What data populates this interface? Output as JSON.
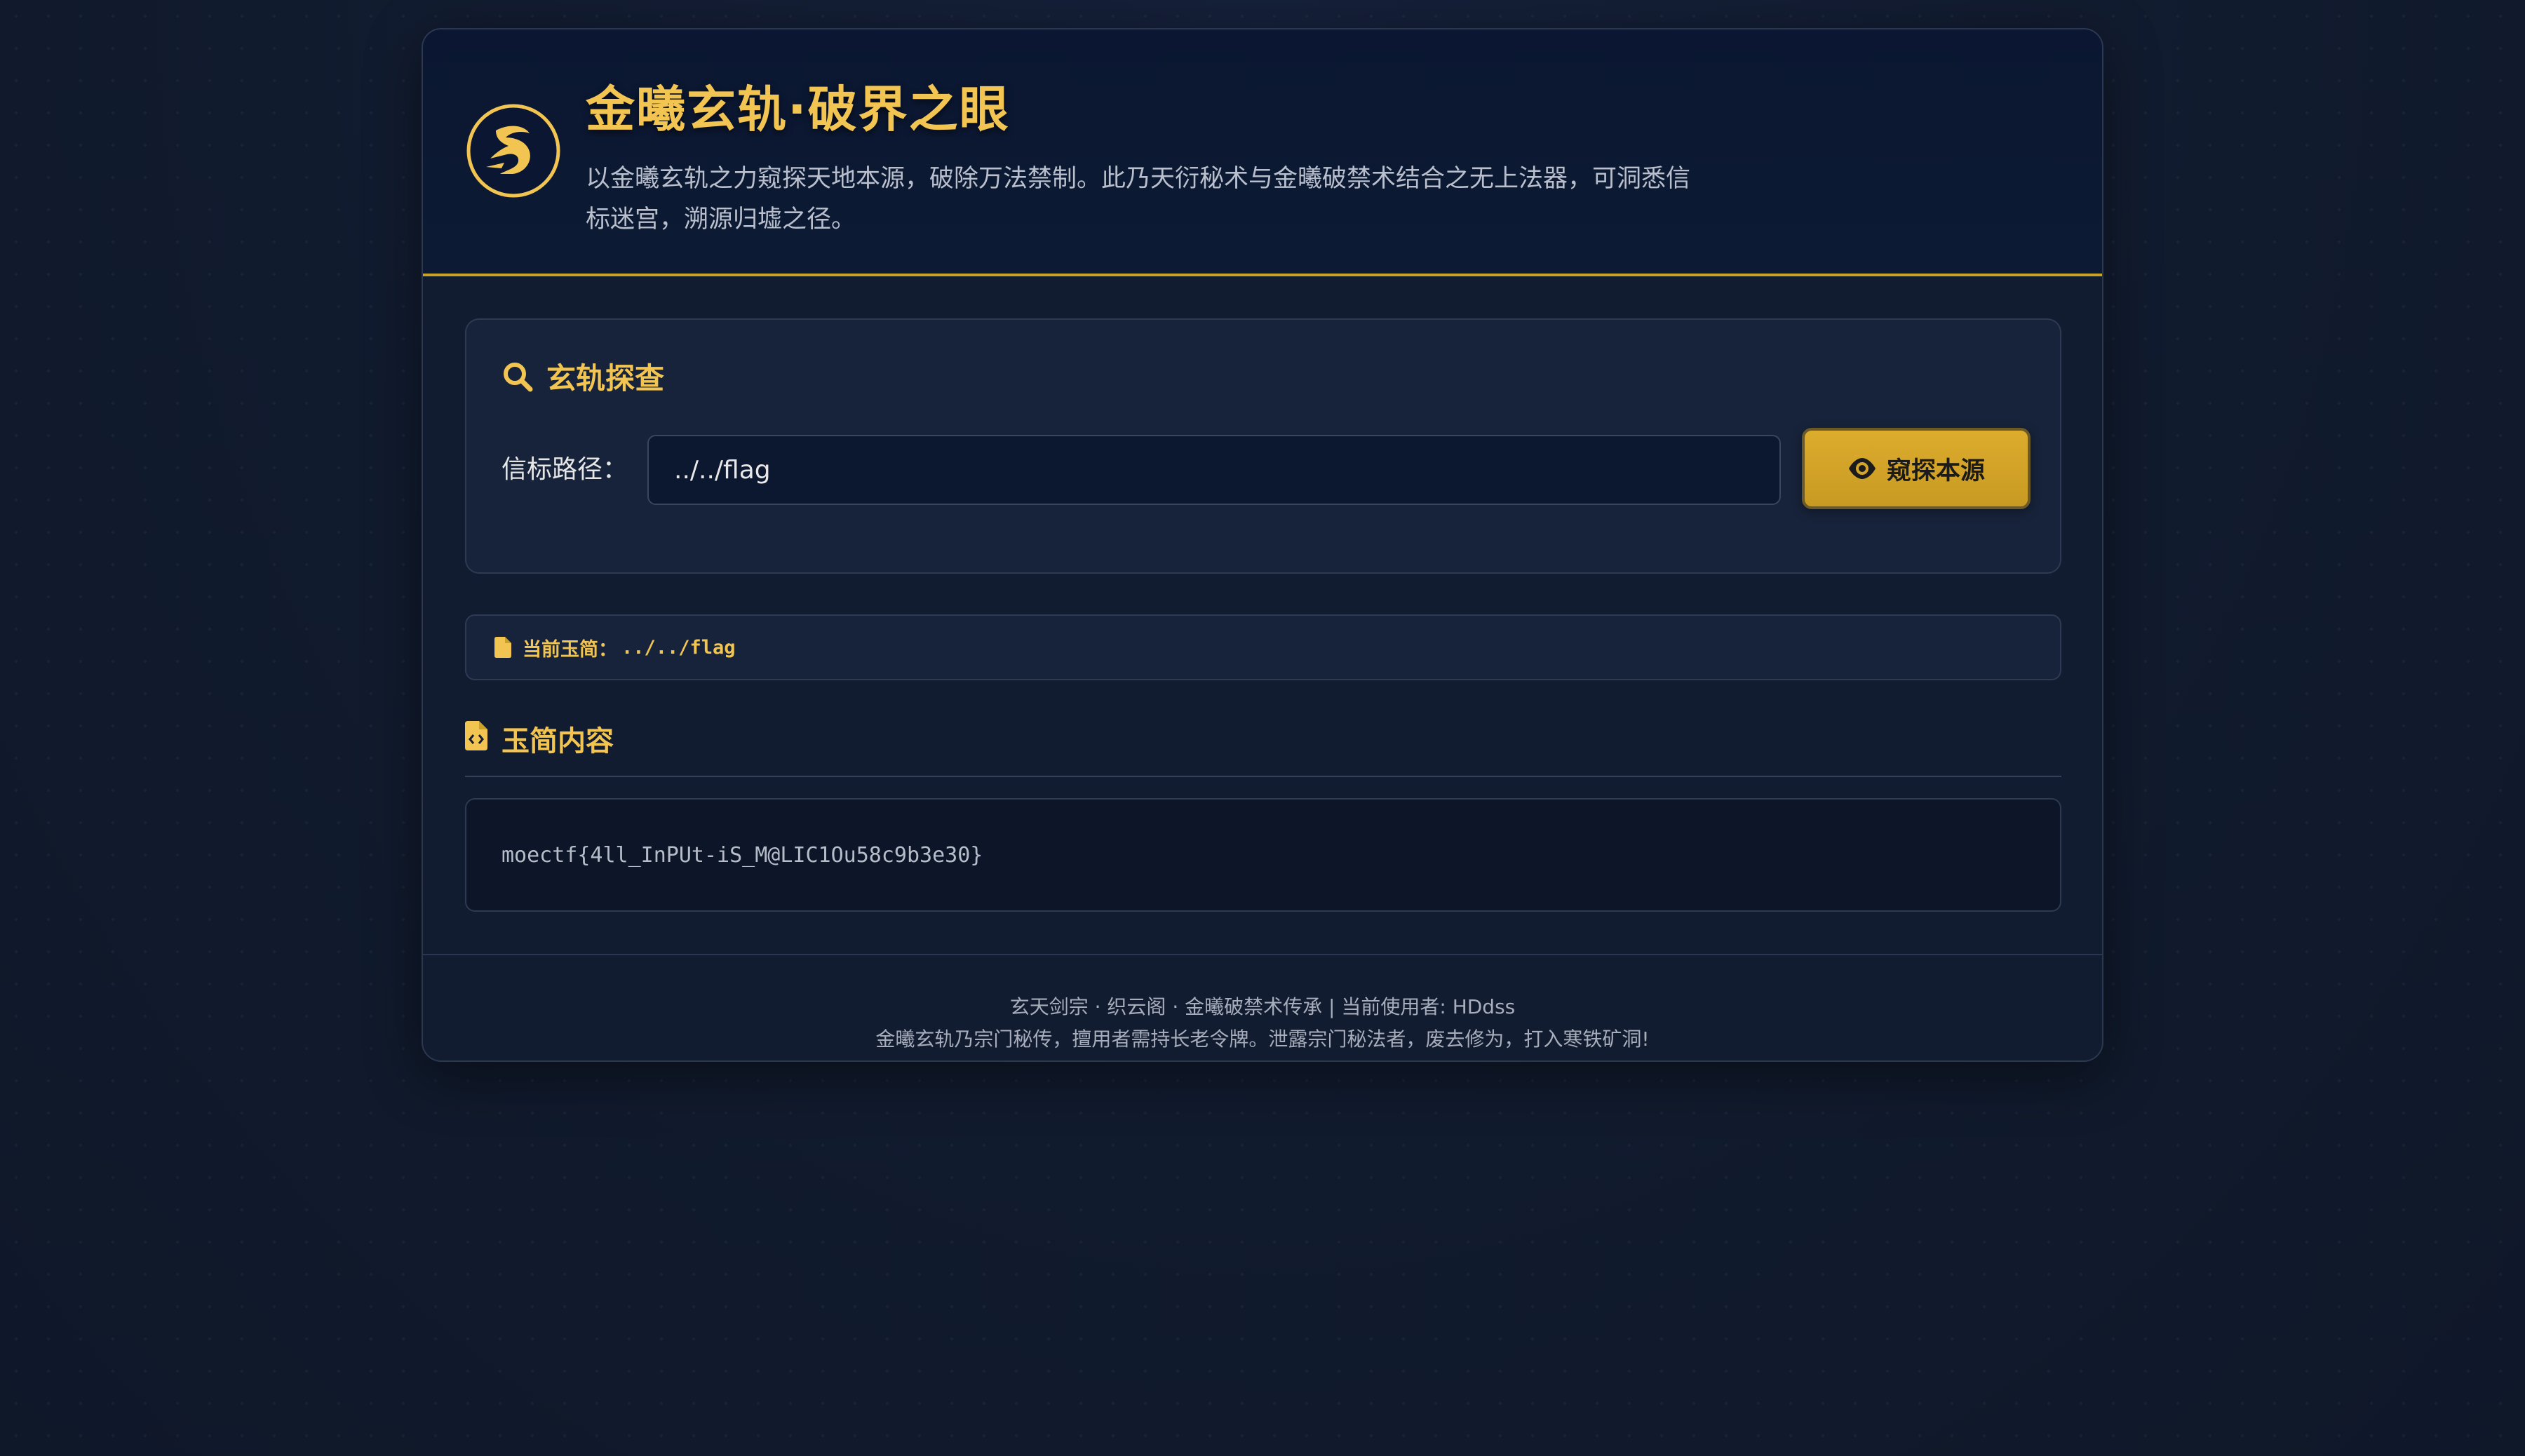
{
  "header": {
    "title": "金曦玄轨·破界之眼",
    "subtitle": "以金曦玄轨之力窥探天地本源，破除万法禁制。此乃天衍秘术与金曦破禁术结合之无上法器，可洞悉信标迷宫，溯源归墟之径。",
    "logo_icon": "dragon-emblem-icon"
  },
  "search": {
    "title": "玄轨探查",
    "path_label": "信标路径：",
    "path_value": "../../flag",
    "button_label": "窥探本源",
    "search_icon": "search-icon",
    "button_icon": "eye-icon"
  },
  "current": {
    "label": "当前玉简：",
    "path": "../../flag",
    "icon": "file-icon"
  },
  "content": {
    "heading": "玉简内容",
    "icon": "file-code-icon",
    "text": "moectf{4ll_InPUt-iS_M@LIC1Ou58c9b3e30}"
  },
  "footer": {
    "line1": "玄天剑宗 · 织云阁 · 金曦破禁术传承 | 当前使用者: HDdss",
    "line2": "金曦玄轨乃宗门秘传，擅用者需持长老令牌。泄露宗门秘法者，废去修为，打入寒铁矿洞!"
  },
  "colors": {
    "accent": "#f2c452",
    "button": "#d4a52a",
    "background": "#111b2e",
    "card": "#17233a"
  }
}
